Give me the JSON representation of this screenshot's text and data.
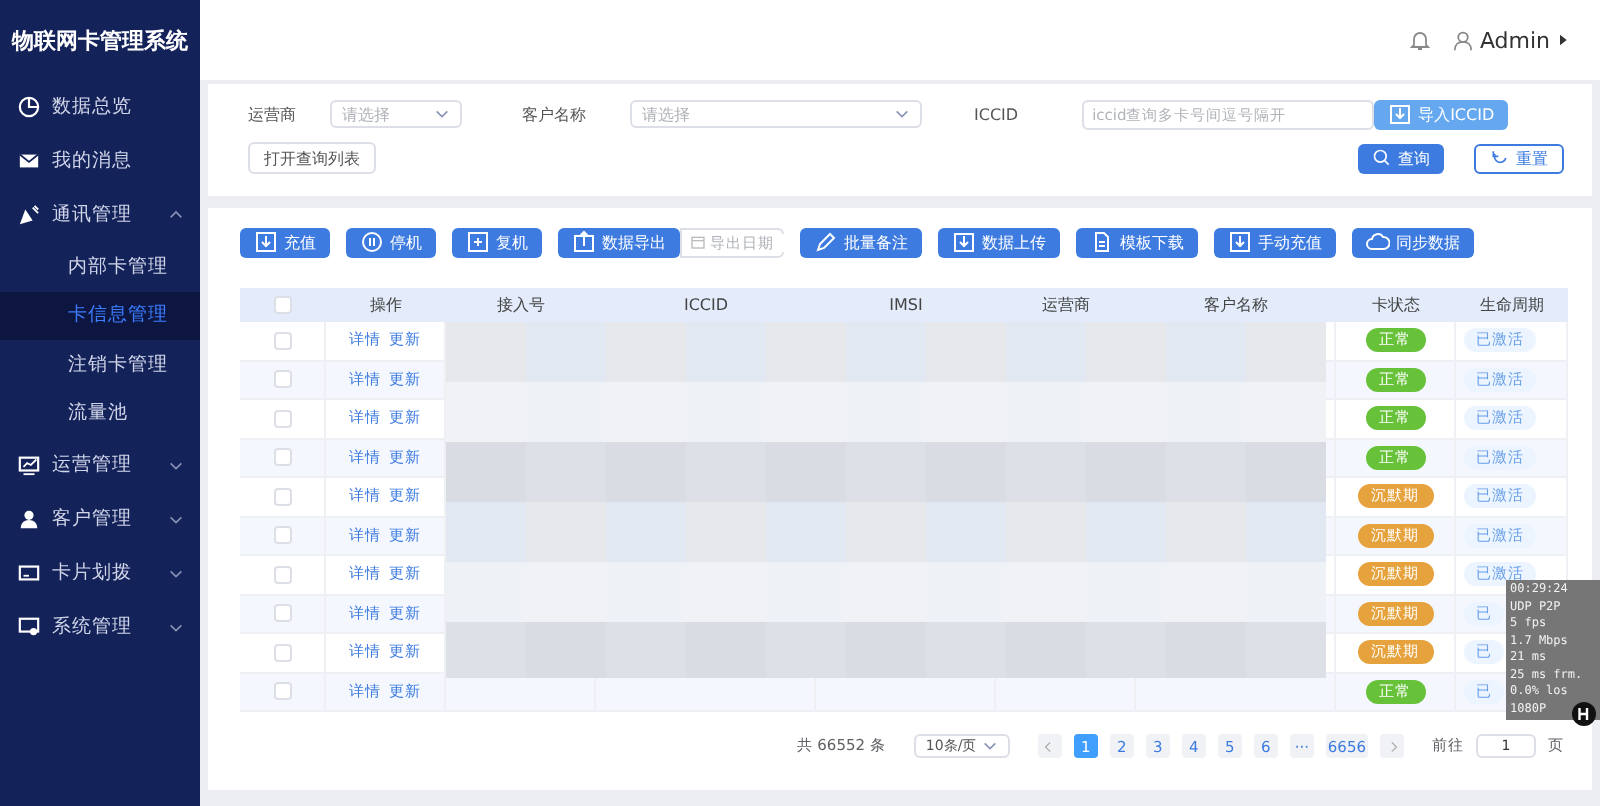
{
  "sidebar": {
    "title": "物联网卡管理系统",
    "items": [
      {
        "label": "数据总览"
      },
      {
        "label": "我的消息"
      },
      {
        "label": "通讯管理",
        "expanded": true,
        "children": [
          {
            "label": "内部卡管理",
            "selected": false
          },
          {
            "label": "卡信息管理",
            "selected": true
          },
          {
            "label": "注销卡管理",
            "selected": false
          },
          {
            "label": "流量池",
            "selected": false
          }
        ]
      },
      {
        "label": "运营管理",
        "expanded": false
      },
      {
        "label": "客户管理",
        "expanded": false
      },
      {
        "label": "卡片划拨",
        "expanded": false
      },
      {
        "label": "系统管理",
        "expanded": false
      }
    ]
  },
  "header": {
    "user": "Admin"
  },
  "filters": {
    "operator": {
      "label": "运营商",
      "placeholder": "请选择"
    },
    "customer": {
      "label": "客户名称",
      "placeholder": "请选择"
    },
    "iccid": {
      "label": "ICCID",
      "placeholder": "iccid查询多卡号间逗号隔开"
    },
    "import_button": "导入ICCID",
    "open_list_button": "打开查询列表",
    "search_button": "查询",
    "reset_button": "重置"
  },
  "toolbar": {
    "buttons": [
      "充值",
      "停机",
      "复机",
      "数据导出"
    ],
    "date_placeholder": "导出日期",
    "buttons_after": [
      "批量备注",
      "数据上传",
      "模板下载",
      "手动充值",
      "同步数据"
    ]
  },
  "table": {
    "columns": [
      "操作",
      "接入号",
      "ICCID",
      "IMSI",
      "运营商",
      "客户名称",
      "卡状态",
      "生命周期"
    ],
    "all_checked": false,
    "rows": [
      {
        "checked": false,
        "actions": [
          "详情",
          "更新"
        ],
        "status": "正常",
        "color": "#67c23a",
        "lifecycle": "已激活"
      },
      {
        "checked": false,
        "actions": [
          "详情",
          "更新"
        ],
        "status": "正常",
        "color": "#67c23a",
        "lifecycle": "已激活"
      },
      {
        "checked": false,
        "actions": [
          "详情",
          "更新"
        ],
        "status": "正常",
        "color": "#67c23a",
        "lifecycle": "已激活"
      },
      {
        "checked": false,
        "actions": [
          "详情",
          "更新"
        ],
        "status": "正常",
        "color": "#67c23a",
        "lifecycle": "已激活"
      },
      {
        "checked": false,
        "actions": [
          "详情",
          "更新"
        ],
        "status": "沉默期",
        "color": "#e6a23c",
        "lifecycle": "已激活"
      },
      {
        "checked": false,
        "actions": [
          "详情",
          "更新"
        ],
        "status": "沉默期",
        "color": "#e6a23c",
        "lifecycle": "已激活"
      },
      {
        "checked": false,
        "actions": [
          "详情",
          "更新"
        ],
        "status": "沉默期",
        "color": "#e6a23c",
        "lifecycle": "已激活"
      },
      {
        "checked": false,
        "actions": [
          "详情",
          "更新"
        ],
        "status": "沉默期",
        "color": "#e6a23c",
        "lifecycle": "已"
      },
      {
        "checked": false,
        "actions": [
          "详情",
          "更新"
        ],
        "status": "沉默期",
        "color": "#e6a23c",
        "lifecycle": "已"
      },
      {
        "checked": false,
        "actions": [
          "详情",
          "更新"
        ],
        "status": "正常",
        "color": "#67c23a",
        "lifecycle": "已"
      }
    ]
  },
  "pagination": {
    "total": "共 66552 条",
    "page_size": "10条/页",
    "pages": [
      {
        "label": "1",
        "selected": true
      },
      {
        "label": "2",
        "selected": false
      },
      {
        "label": "3",
        "selected": false
      },
      {
        "label": "4",
        "selected": false
      },
      {
        "label": "5",
        "selected": false
      },
      {
        "label": "6",
        "selected": false
      },
      {
        "label": "···",
        "selected": false
      },
      {
        "label": "6656",
        "selected": false
      }
    ],
    "goto_label": "前往",
    "goto_value": "1",
    "goto_suffix": "页"
  },
  "stream_overlay": {
    "lines": [
      "00:29:24",
      "UDP P2P",
      "5 fps",
      "1.7 Mbps",
      "21 ms",
      "25 ms frm.",
      "0.0% los",
      "1080P"
    ]
  }
}
